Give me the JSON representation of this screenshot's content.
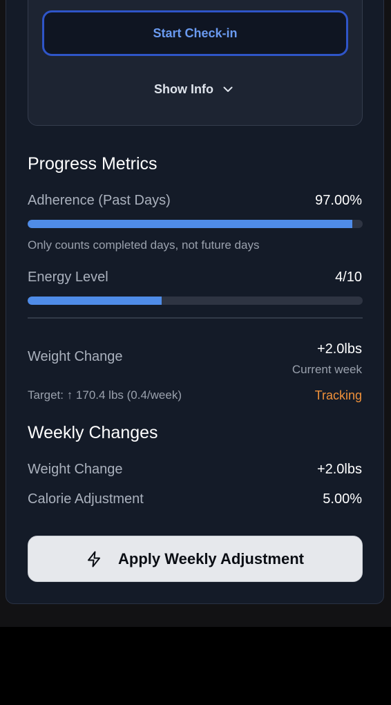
{
  "checkin": {
    "start_label": "Start Check-in",
    "show_info_label": "Show Info",
    "show_info_icon": "chevron-down-icon"
  },
  "progress": {
    "title": "Progress Metrics",
    "adherence": {
      "label": "Adherence (Past Days)",
      "value": "97.00%",
      "percent": 97,
      "note": "Only counts completed days, not future days"
    },
    "energy": {
      "label": "Energy Level",
      "value": "4/10",
      "percent": 40
    },
    "weight": {
      "label": "Weight Change",
      "value": "+2.0lbs",
      "sublabel": "Current week",
      "target": "Target: ↑ 170.4 lbs (0.4/week)",
      "status": "Tracking"
    }
  },
  "weekly": {
    "title": "Weekly Changes",
    "weight_label": "Weight Change",
    "weight_value": "+2.0lbs",
    "calorie_label": "Calorie Adjustment",
    "calorie_value": "5.00%"
  },
  "apply": {
    "label": "Apply Weekly Adjustment",
    "icon": "lightning-bolt-icon"
  },
  "colors": {
    "accent_blue": "#4f8ce8",
    "tracking_orange": "#f0913a",
    "card_bg": "#141b28"
  }
}
